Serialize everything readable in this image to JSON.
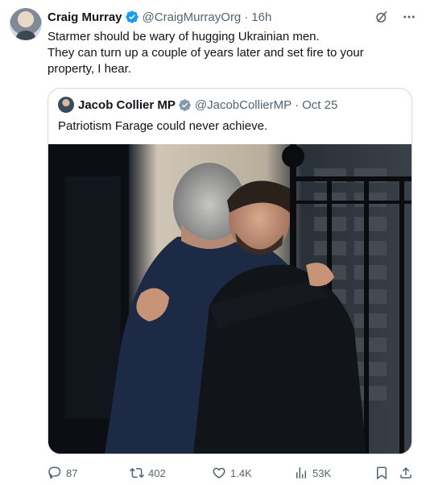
{
  "tweet": {
    "author_name": "Craig Murray",
    "author_handle": "@CraigMurrayOrg",
    "separator": "·",
    "time": "16h",
    "text_lines": [
      "Starmer should be wary of hugging Ukrainian men.",
      "They can turn up a couple of years later and set fire to your",
      "property, I hear."
    ]
  },
  "quoted_tweet": {
    "author_name": "Jacob Collier MP",
    "author_handle": "@JacobCollierMP",
    "separator": "·",
    "date": "Oct 25",
    "text": "Patriotism Farage could never achieve."
  },
  "actions": {
    "replies": "87",
    "reposts": "402",
    "likes": "1.4K",
    "views": "53K"
  },
  "colors": {
    "verified_blue": "#1d9bf0",
    "muted_text": "#536471",
    "border": "#cfd9de"
  },
  "icons": [
    "grok-icon",
    "more-icon",
    "verified-badge-icon",
    "reply-icon",
    "repost-icon",
    "like-icon",
    "views-icon",
    "bookmark-icon",
    "share-icon"
  ]
}
